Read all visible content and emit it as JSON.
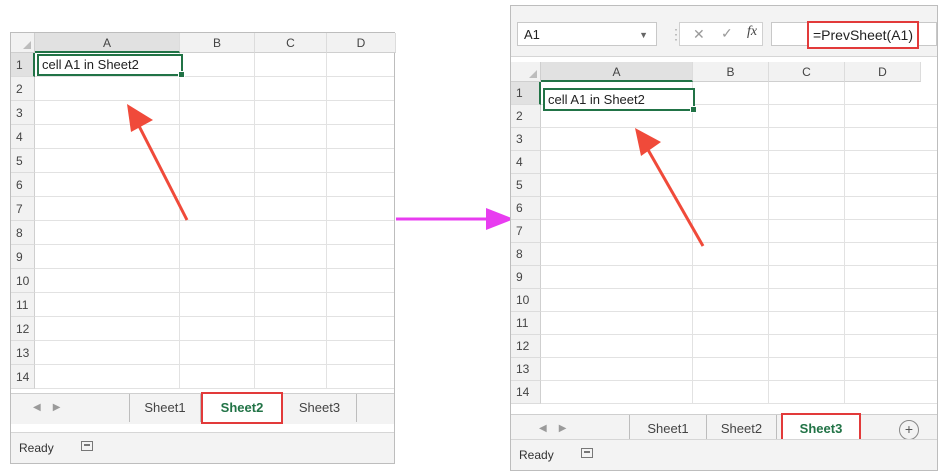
{
  "left": {
    "columns": [
      "A",
      "B",
      "C",
      "D"
    ],
    "rows": [
      "1",
      "2",
      "3",
      "4",
      "5",
      "6",
      "7",
      "8",
      "9",
      "10",
      "11",
      "12",
      "13",
      "14"
    ],
    "cell_a1": "cell A1 in Sheet2",
    "tabs": [
      "Sheet1",
      "Sheet2",
      "Sheet3"
    ],
    "active_tab": "Sheet2",
    "status": "Ready"
  },
  "right": {
    "name_box": "A1",
    "formula": "=PrevSheet(A1)",
    "fx_label": "fx",
    "columns": [
      "A",
      "B",
      "C",
      "D"
    ],
    "rows": [
      "1",
      "2",
      "3",
      "4",
      "5",
      "6",
      "7",
      "8",
      "9",
      "10",
      "11",
      "12",
      "13",
      "14"
    ],
    "cell_a1": "cell A1 in Sheet2",
    "tabs": [
      "Sheet1",
      "Sheet2",
      "Sheet3"
    ],
    "active_tab": "Sheet3",
    "status": "Ready"
  },
  "colors": {
    "highlight_red": "#e23a3a",
    "excel_green": "#217346",
    "arrow_magenta": "#e83cf0",
    "callout_arrow": "#f04a3a"
  }
}
